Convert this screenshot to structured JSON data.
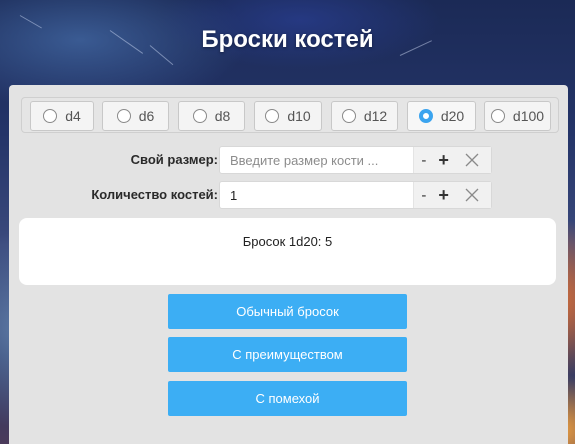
{
  "header": {
    "title": "Броски костей"
  },
  "dice": {
    "options": [
      {
        "label": "d4",
        "selected": false
      },
      {
        "label": "d6",
        "selected": false
      },
      {
        "label": "d8",
        "selected": false
      },
      {
        "label": "d10",
        "selected": false
      },
      {
        "label": "d12",
        "selected": false
      },
      {
        "label": "d20",
        "selected": true
      },
      {
        "label": "d100",
        "selected": false
      }
    ]
  },
  "custom_size": {
    "label": "Свой размер:",
    "value": "",
    "placeholder": "Введите размер кости ...",
    "minus": "-",
    "plus": "+"
  },
  "dice_count": {
    "label": "Количество костей:",
    "value": "1",
    "placeholder": "",
    "minus": "-",
    "plus": "+"
  },
  "result": {
    "text": "Бросок 1d20: 5"
  },
  "buttons": {
    "normal": "Обычный бросок",
    "advantage": "С преимуществом",
    "disadvantage": "С помехой"
  },
  "colors": {
    "accent": "#3caef4",
    "radio_selected": "#3ba4ef",
    "panel": "#e3e3e3"
  },
  "icons": {
    "clear": "close-x-icon",
    "radio": "radio-icon"
  }
}
